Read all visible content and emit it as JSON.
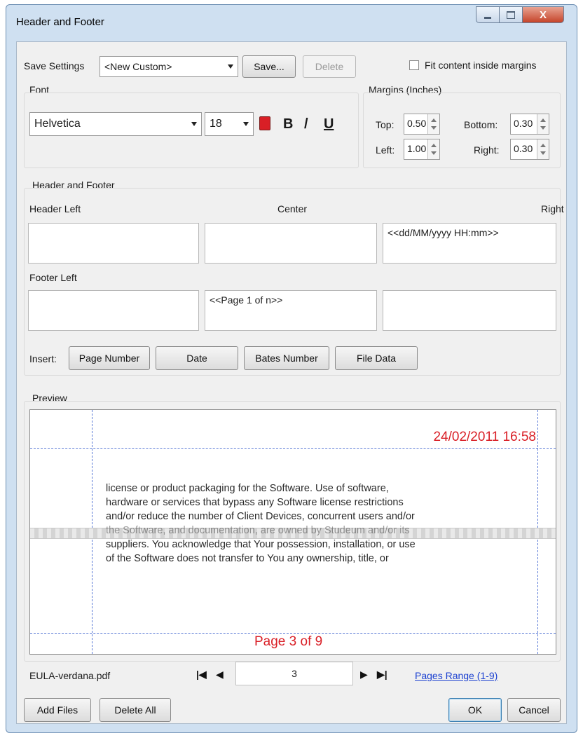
{
  "window": {
    "title": "Header and Footer",
    "close_glyph": "X"
  },
  "settings": {
    "label": "Save Settings",
    "selected": "<New Custom>",
    "save_button": "Save...",
    "delete_button": "Delete",
    "fit_label": "Fit content inside margins",
    "fit_checked": false
  },
  "font": {
    "group_label": "Font",
    "family": "Helvetica",
    "size": "18",
    "color": "#d91f26",
    "bold": "B",
    "italic": "/",
    "underline": "U"
  },
  "margins": {
    "group_label": "Margins (Inches)",
    "top_label": "Top:",
    "top": "0.50",
    "bottom_label": "Bottom:",
    "bottom": "0.30",
    "left_label": "Left:",
    "left": "1.00",
    "right_label": "Right:",
    "right": "0.30"
  },
  "hf": {
    "group_label": "Header and Footer",
    "header_left_label": "Header Left",
    "center_label": "Center",
    "right_label": "Right",
    "header_left": "",
    "header_center": "",
    "header_right": "<<dd/MM/yyyy HH:mm>>",
    "footer_left_label": "Footer Left",
    "footer_left": "",
    "footer_center": "<<Page 1 of n>>",
    "footer_right": ""
  },
  "insert": {
    "label": "Insert:",
    "buttons": [
      "Page Number",
      "Date",
      "Bates Number",
      "File Data"
    ]
  },
  "preview": {
    "label": "Preview",
    "header_text": "24/02/2011 16:58",
    "footer_text": "Page 3 of 9",
    "body_lines": [
      "license or product packaging for the Software.  Use of software,",
      "hardware or services that bypass any Software license restrictions",
      "and/or reduce the number of Client Devices, concurrent users and/or",
      "the Software, and documentation, are owned by Studeum and/or its",
      "suppliers.  You acknowledge that Your possession, installation, or use",
      "of the Software does not transfer to You any ownership, title, or"
    ]
  },
  "navigation": {
    "file_name": "EULA-verdana.pdf",
    "page": "3",
    "pages_range": "Pages Range (1-9)"
  },
  "footer_buttons": {
    "add_files": "Add Files",
    "delete_all": "Delete All",
    "ok": "OK",
    "cancel": "Cancel"
  },
  "colors": {
    "accent": "#d91f26",
    "link": "#1a3fd0",
    "guides": "#5b7bd6"
  }
}
